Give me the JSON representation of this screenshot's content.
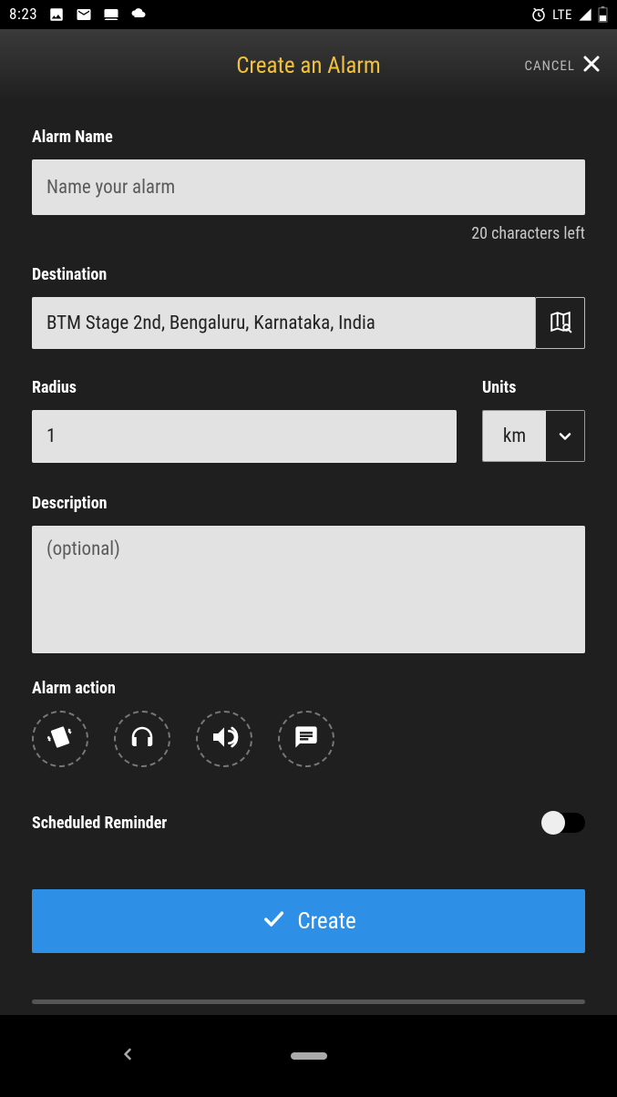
{
  "status": {
    "time": "8:23",
    "network": "LTE"
  },
  "header": {
    "title": "Create an Alarm",
    "cancel": "CANCEL"
  },
  "alarmName": {
    "label": "Alarm Name",
    "placeholder": "Name your alarm",
    "value": "",
    "charsLeft": "20 characters left"
  },
  "destination": {
    "label": "Destination",
    "value": "BTM Stage 2nd, Bengaluru, Karnataka, India"
  },
  "radius": {
    "label": "Radius",
    "value": "1"
  },
  "units": {
    "label": "Units",
    "value": "km"
  },
  "description": {
    "label": "Description",
    "placeholder": "(optional)",
    "value": ""
  },
  "alarmAction": {
    "label": "Alarm action"
  },
  "reminder": {
    "label": "Scheduled Reminder",
    "on": false
  },
  "createButton": {
    "label": "Create"
  }
}
